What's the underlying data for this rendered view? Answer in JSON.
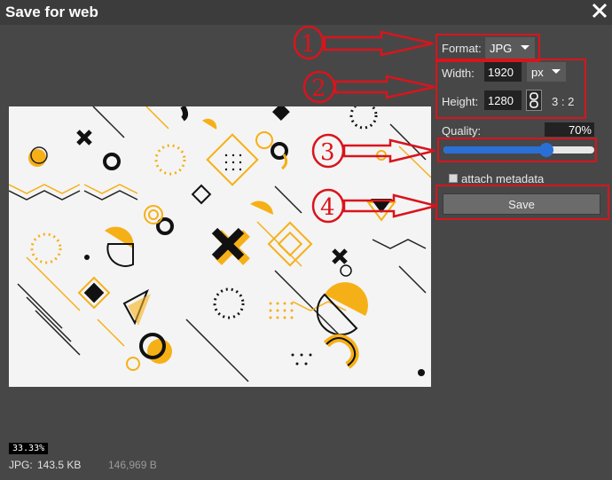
{
  "window": {
    "title": "Save for web"
  },
  "format": {
    "label": "Format:",
    "value": "JPG"
  },
  "width": {
    "label": "Width:",
    "value": "1920",
    "unit": "px"
  },
  "height": {
    "label": "Height:",
    "value": "1280",
    "ratio": "3 : 2"
  },
  "quality": {
    "label": "Quality:",
    "value": "70%",
    "level": 0.7
  },
  "metadata": {
    "label": "attach metadata",
    "checked": false
  },
  "save": {
    "label": "Save"
  },
  "footer": {
    "zoom": "33.33%",
    "format": "JPG:",
    "size": "143.5 KB",
    "bytes": "146,969 B"
  },
  "annotations": [
    "1",
    "2",
    "3",
    "4"
  ],
  "colors": {
    "accent": "#d9141c",
    "slider": "#2a6fd6",
    "preview_yellow": "#f6b017"
  },
  "icons": {
    "close": "close-icon",
    "link": "chain-link-icon",
    "caret": "chevron-down-icon"
  }
}
